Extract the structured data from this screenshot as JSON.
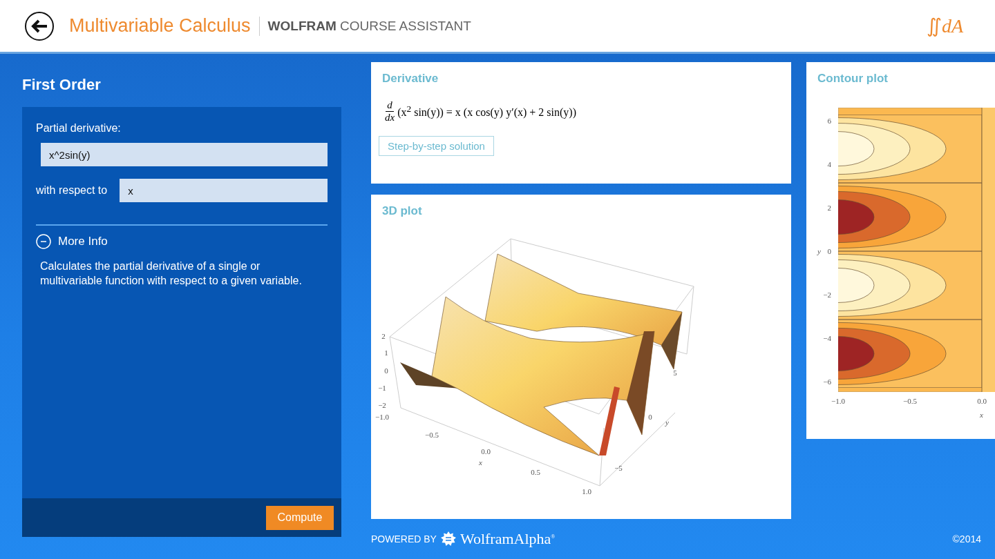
{
  "header": {
    "title": "Multivariable Calculus",
    "brand_bold": "WOLFRAM",
    "brand": "COURSE ASSISTANT",
    "logo_integral": "∬",
    "logo_text": "dA"
  },
  "form": {
    "heading": "First Order",
    "fields": [
      {
        "kind": "stacked",
        "label": "Partial derivative:",
        "value": "x^2sin(y)"
      },
      {
        "kind": "inline",
        "label": "with respect to",
        "value": "x"
      }
    ],
    "more_info": {
      "label": "More Info",
      "expanded": true,
      "text": "Calculates the partial derivative of a single or multivariable function with respect to a given variable."
    },
    "button": "Compute"
  },
  "derivative": {
    "title": "Derivative",
    "numerator": "d",
    "denominator": "dx",
    "expression": "(x$^{2}$ sin(y)) = x (x cos(y) y′(x) + 2 sin(y))",
    "button": "Step-by-step solution"
  },
  "plot_3d": {
    "title": "3D plot",
    "z_ticks": [
      "2",
      "1",
      "0",
      "−1",
      "−2"
    ],
    "x_ticks": [
      "−1.0",
      "−0.5",
      "0.0",
      "0.5",
      "1.0"
    ],
    "y_ticks": [
      "5",
      "0",
      "−5"
    ],
    "x_label": "x",
    "y_label": "y"
  },
  "contour_plot": {
    "title": "Contour plot",
    "y_ticks": [
      "6",
      "4",
      "2",
      "0",
      "−2",
      "−4",
      "−6"
    ],
    "x_ticks": [
      "−1.0",
      "−0.5",
      "0.0"
    ],
    "x_label": "x",
    "y_label": "y"
  },
  "footer": {
    "powered_by": "POWERED BY",
    "brand": "WolframAlpha$^{®}$",
    "copyright": "©2014"
  }
}
